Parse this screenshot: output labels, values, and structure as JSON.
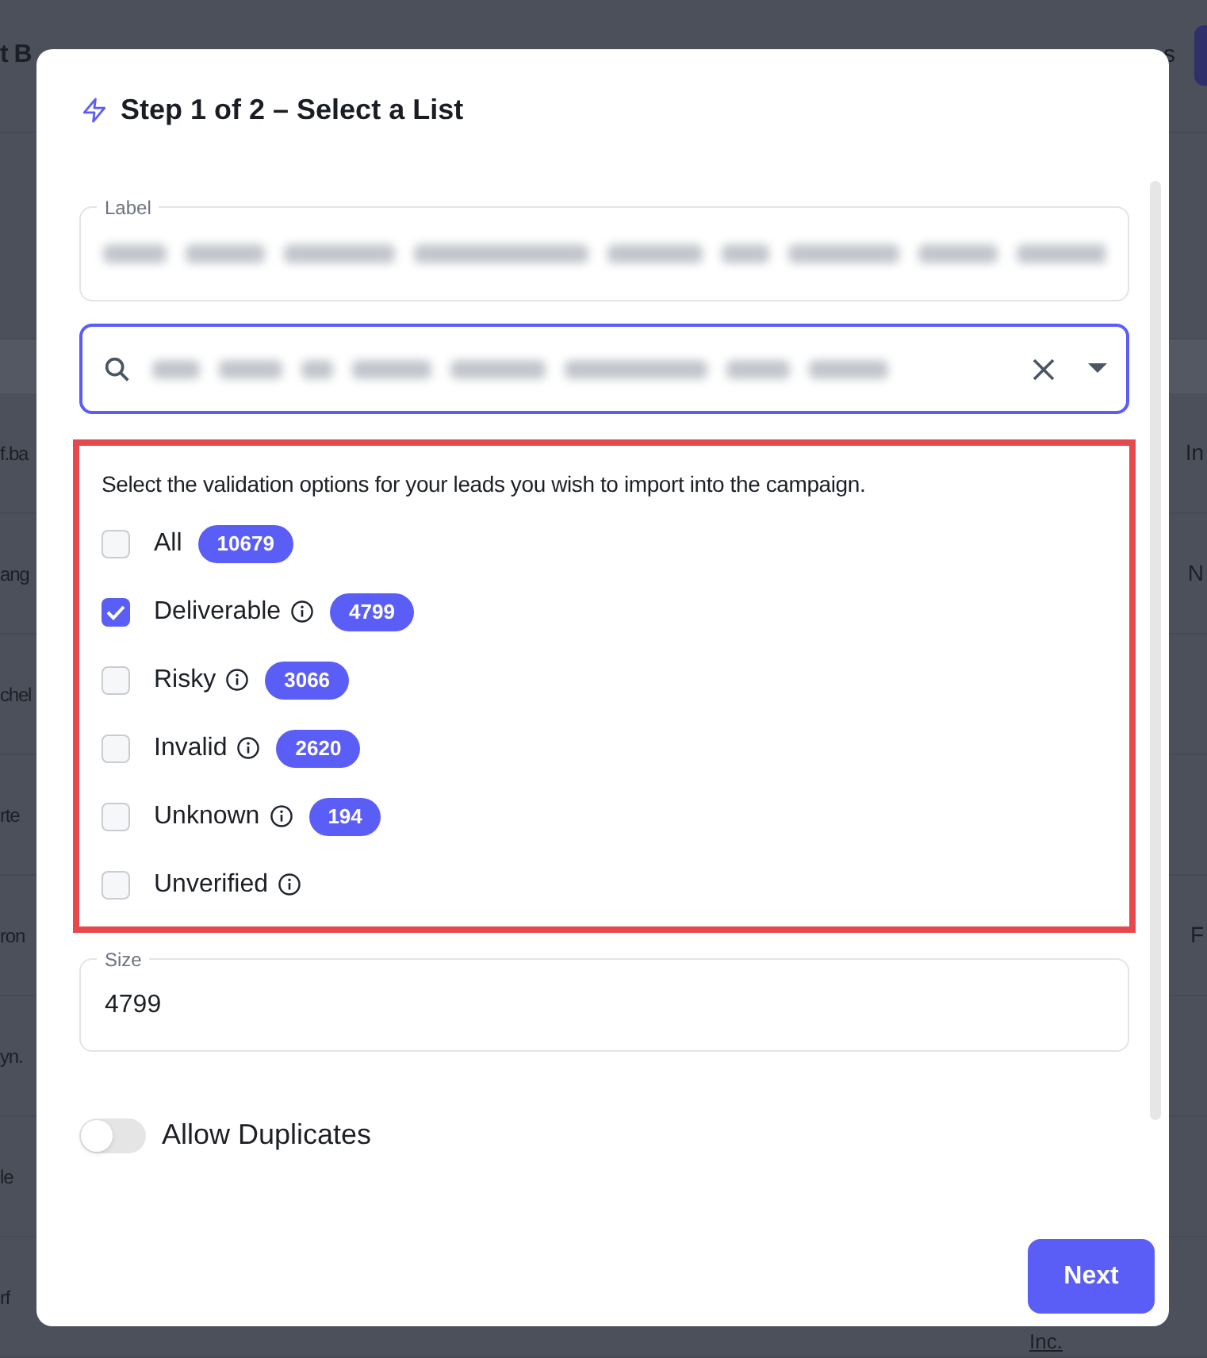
{
  "background": {
    "header_title": "t B",
    "header_action": "s",
    "rows": [
      {
        "left": "f.ba",
        "right": "In"
      },
      {
        "left": "ang",
        "right": "N"
      },
      {
        "left": "chel"
      },
      {
        "left": "rte"
      },
      {
        "left": "ron",
        "right": "F"
      },
      {
        "left": "yn."
      },
      {
        "left": "le"
      },
      {
        "left": "rf"
      }
    ],
    "footer_link": "Inc."
  },
  "dialog": {
    "title": "Step 1 of 2 – Select a List",
    "label_field": {
      "label": "Label"
    },
    "validation": {
      "prompt": "Select the validation options for your leads you wish to import into the campaign.",
      "options": [
        {
          "label": "All",
          "checked": false,
          "info": false,
          "count": "10679"
        },
        {
          "label": "Deliverable",
          "checked": true,
          "info": true,
          "count": "4799"
        },
        {
          "label": "Risky",
          "checked": false,
          "info": true,
          "count": "3066"
        },
        {
          "label": "Invalid",
          "checked": false,
          "info": true,
          "count": "2620"
        },
        {
          "label": "Unknown",
          "checked": false,
          "info": true,
          "count": "194"
        },
        {
          "label": "Unverified",
          "checked": false,
          "info": true
        }
      ]
    },
    "size_field": {
      "label": "Size",
      "value": "4799"
    },
    "allow_duplicates": {
      "label": "Allow Duplicates",
      "on": false
    },
    "next_button": "Next"
  }
}
